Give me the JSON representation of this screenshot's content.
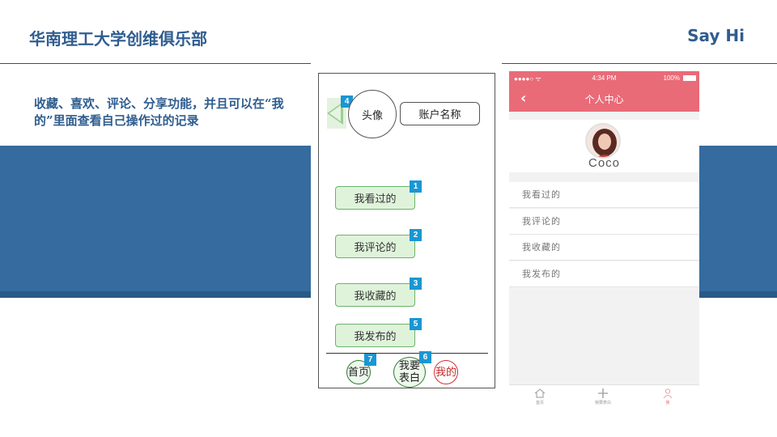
{
  "header": {
    "title": "华南理工大学创维俱乐部",
    "brand": "Say Hi"
  },
  "description": "收藏、喜欢、评论、分享功能，并且可以在“我的”里面查看自己操作过的记录",
  "colors": {
    "brand_blue": "#2f5d8f",
    "band_blue": "#356b9e",
    "wire_green": "#dff3db",
    "badge_blue": "#1a96d4",
    "phone_header": "#e96b78"
  },
  "wireframe": {
    "avatar_label": "头像",
    "account_label": "账户名称",
    "back_badge": "4",
    "items": [
      {
        "label": "我看过的",
        "badge": "1"
      },
      {
        "label": "我评论的",
        "badge": "2"
      },
      {
        "label": "我收藏的",
        "badge": "3"
      },
      {
        "label": "我发布的",
        "badge": "5"
      }
    ],
    "tabs": {
      "home": {
        "label": "首页",
        "badge": "7"
      },
      "post": {
        "label": "我要表白",
        "badge": "6"
      },
      "mine": {
        "label": "我的"
      }
    }
  },
  "phone": {
    "status": {
      "signal": "●●●●○ ᯤ",
      "time": "4:34 PM",
      "battery": "100%"
    },
    "nav_title": "个人中心",
    "user_name": "Coco",
    "menu": [
      "我看过的",
      "我评论的",
      "我收藏的",
      "我发布的"
    ],
    "tabbar": [
      {
        "label": "首页",
        "icon": "home-icon"
      },
      {
        "label": "我要表白",
        "icon": "plus-icon"
      },
      {
        "label": "我",
        "icon": "user-icon"
      }
    ]
  }
}
